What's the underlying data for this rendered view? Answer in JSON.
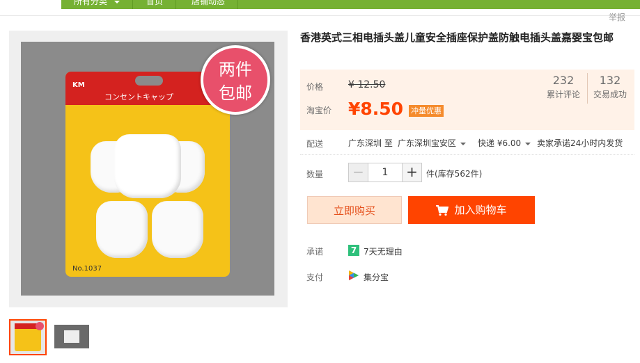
{
  "nav": {
    "items": [
      "所有分类",
      "首页",
      "店铺动态"
    ]
  },
  "report_label": "举报",
  "product": {
    "title": "香港英式三相电插头盖儿童安全插座保护盖防触电插头盖嘉婴宝包邮",
    "badge_line1": "两件",
    "badge_line2": "包邮",
    "package_brand": "KM",
    "package_title": "コンセントキャップ",
    "package_no": "No.1037"
  },
  "price": {
    "label": "价格",
    "old": "¥ 12.50",
    "taobao_label": "淘宝价",
    "current": "¥8.50",
    "promo_tag": "冲量优惠"
  },
  "stats": [
    {
      "value": "232",
      "label": "累计评论"
    },
    {
      "value": "132",
      "label": "交易成功"
    }
  ],
  "shipping": {
    "label": "配送",
    "from": "广东深圳 至",
    "to": "广东深圳宝安区",
    "method": "快递 ¥6.00",
    "promise": "卖家承诺24小时内发货"
  },
  "quantity": {
    "label": "数量",
    "minus": "−",
    "value": "1",
    "plus": "+",
    "stock": "件(库存562件)"
  },
  "buttons": {
    "buy_now": "立即购买",
    "add_to_cart": "加入购物车"
  },
  "services": {
    "promise_label": "承诺",
    "promise_icon_text": "7",
    "promise_text": "7天无理由",
    "pay_label": "支付",
    "pay_text": "集分宝"
  },
  "colors": {
    "accent": "#ff4400",
    "nav_green": "#76b133",
    "promise_green": "#2ec07b"
  }
}
